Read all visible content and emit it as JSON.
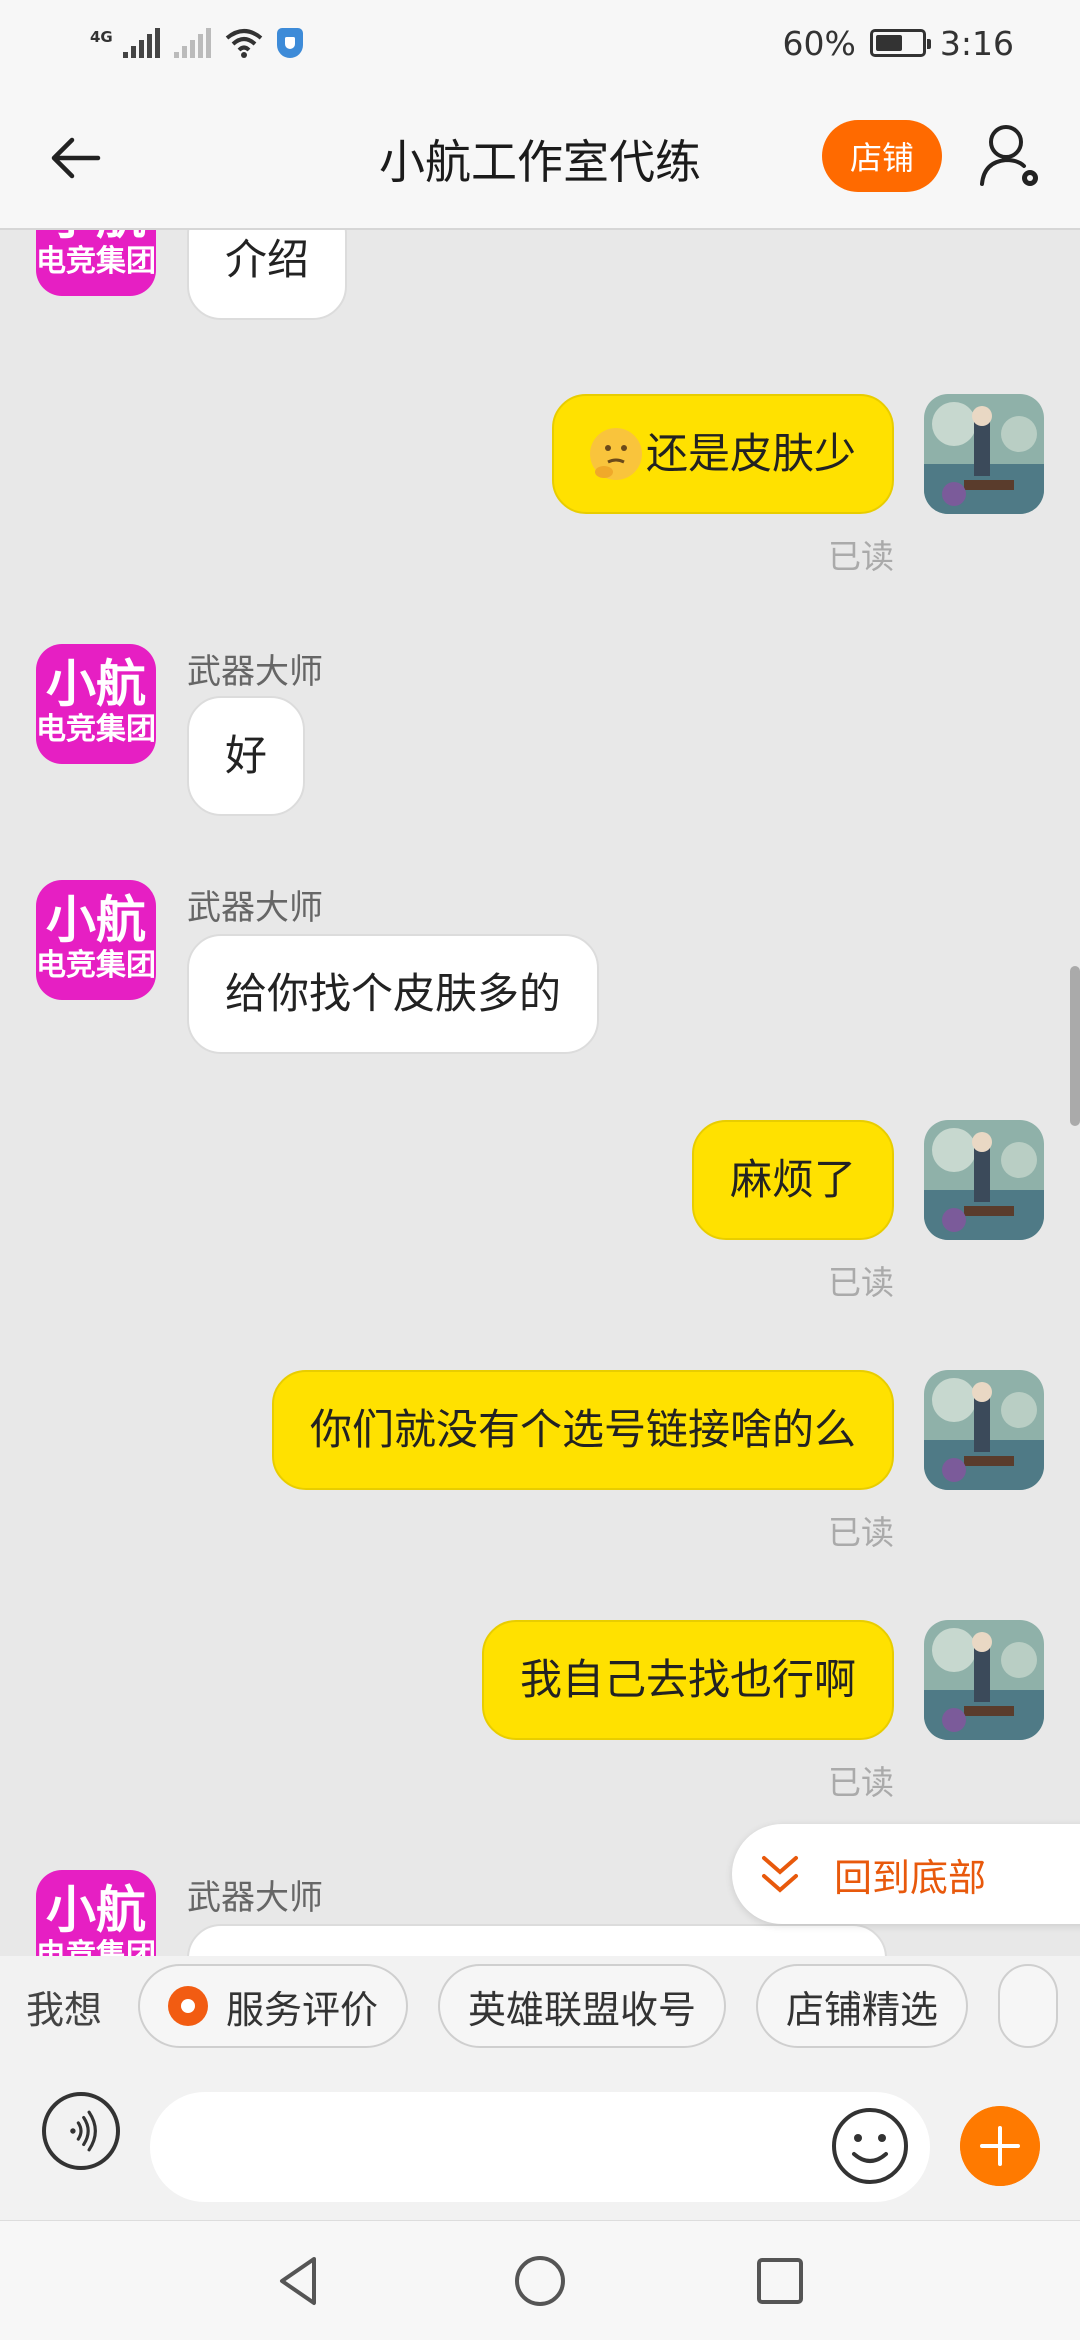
{
  "status_bar": {
    "network": "4G",
    "battery_percent": "60%",
    "battery_level": 0.6,
    "time": "3:16",
    "icons": [
      "signal-icon",
      "signal-no-sim-icon",
      "wifi-icon",
      "shield-icon",
      "battery-icon"
    ]
  },
  "header": {
    "title": "小航工作室代练",
    "shop_button": "店铺",
    "icons": [
      "back-arrow-icon",
      "profile-settings-icon"
    ]
  },
  "shop_avatar": {
    "line1": "小航",
    "line2": "电竞集团"
  },
  "messages": [
    {
      "side": "in",
      "sender": "",
      "text": "介绍"
    },
    {
      "side": "out",
      "emoji": "thinking-face-icon",
      "text": "还是皮肤少",
      "status": "已读"
    },
    {
      "side": "in",
      "sender": "武器大师",
      "text": "好"
    },
    {
      "side": "in",
      "sender": "武器大师",
      "text": "给你找个皮肤多的"
    },
    {
      "side": "out",
      "text": "麻烦了",
      "status": "已读"
    },
    {
      "side": "out",
      "text": "你们就没有个选号链接啥的么",
      "status": "已读"
    },
    {
      "side": "out",
      "text": "我自己去找也行啊",
      "status": "已读"
    },
    {
      "side": "in",
      "sender": "武器大师",
      "text": ""
    }
  ],
  "back_to_bottom": "回到底部",
  "quick_bar": {
    "label": "我想",
    "chips": [
      "服务评价",
      "英雄联盟收号",
      "店铺精选"
    ]
  },
  "input": {
    "placeholder": "",
    "icons": [
      "voice-icon",
      "emoji-icon",
      "plus-icon"
    ]
  },
  "colors": {
    "accent_orange": "#ff6a00",
    "outgoing_bubble": "#ffe100",
    "incoming_bubble": "#ffffff",
    "shop_avatar_bg": "#e61fc3"
  }
}
